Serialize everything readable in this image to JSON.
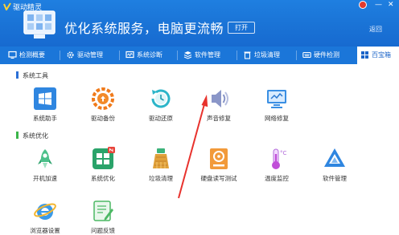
{
  "app": {
    "name": "驱动精灵",
    "slogan": "优化系统服务，电脑更流畅",
    "open_button": "打开",
    "back_link": "返回",
    "min": "—",
    "close": "✕"
  },
  "tabs": [
    {
      "label": "检测概要",
      "icon": "monitor-icon"
    },
    {
      "label": "驱动管理",
      "icon": "gear-icon"
    },
    {
      "label": "系统诊断",
      "icon": "diagnosis-icon"
    },
    {
      "label": "软件管理",
      "icon": "apps-icon"
    },
    {
      "label": "垃圾清理",
      "icon": "trash-icon"
    },
    {
      "label": "硬件检测",
      "icon": "keyboard-icon"
    },
    {
      "label": "百宝箱",
      "icon": "toolbox-icon",
      "active": true
    }
  ],
  "sections": [
    {
      "title": "系统工具",
      "tools": [
        {
          "label": "系统助手",
          "icon": "windows-icon"
        },
        {
          "label": "驱动备份",
          "icon": "backup-gear-icon"
        },
        {
          "label": "驱动还原",
          "icon": "restore-clock-icon"
        },
        {
          "label": "声音修复",
          "icon": "speaker-icon"
        },
        {
          "label": "网络修复",
          "icon": "network-monitor-icon"
        }
      ]
    },
    {
      "title": "系统优化",
      "tools": [
        {
          "label": "开机加速",
          "icon": "rocket-icon"
        },
        {
          "label": "系统优化",
          "icon": "optimize-grid-icon"
        },
        {
          "label": "垃圾清理",
          "icon": "broom-icon"
        },
        {
          "label": "硬盘读写测试",
          "icon": "harddisk-icon"
        },
        {
          "label": "温度监控",
          "icon": "thermometer-icon"
        },
        {
          "label": "软件管理",
          "icon": "software-icon"
        },
        {
          "label": "浏览器设置",
          "icon": "ie-browser-icon"
        },
        {
          "label": "问题反馈",
          "icon": "feedback-icon"
        }
      ]
    }
  ],
  "colors": {
    "header": "#1a73d6",
    "tab_active_text": "#1b64c8",
    "section1_bar": "#2b6fd6",
    "section2_bar": "#3bb54a",
    "arrow": "#e8322d"
  }
}
